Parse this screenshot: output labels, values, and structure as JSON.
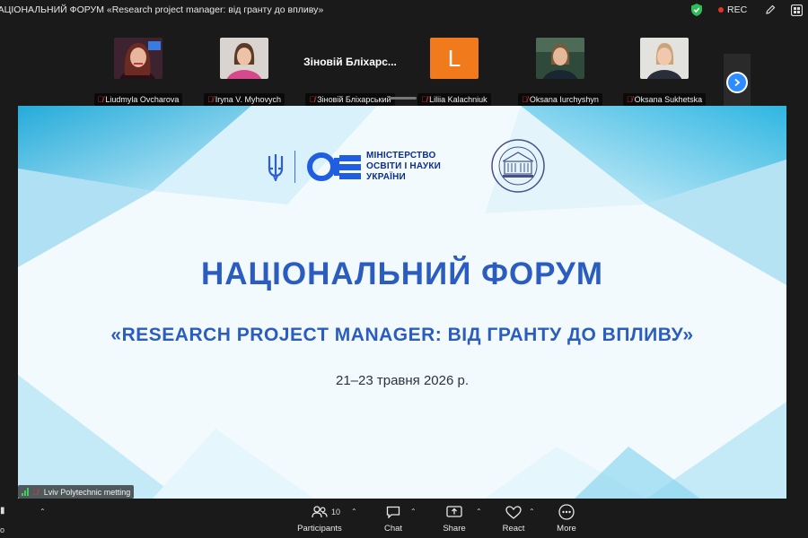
{
  "window": {
    "title": "НАЦІОНАЛЬНИЙ ФОРУМ  «Research project manager: від гранту до впливу»"
  },
  "topbar": {
    "rec_label": "REC",
    "shield_icon": "shield-check-icon",
    "annotate_icon": "pencil-icon",
    "apps_icon": "apps-grid-icon"
  },
  "participants_strip": {
    "tiles": [
      {
        "name": "Liudmyla Ovcharova",
        "muted": true
      },
      {
        "name": "Iryna V. Myhovych",
        "muted": true
      },
      {
        "name": "Зіновій Бліхарський",
        "display": "Зіновій Бліхарс...",
        "muted": true
      },
      {
        "name": "Liliia Kalachniuk",
        "initial": "L",
        "muted": true
      },
      {
        "name": "Oksana Iurchyshyn",
        "muted": true
      },
      {
        "name": "Oksana Sukhetska",
        "muted": true
      }
    ],
    "next_icon": "chevron-right-icon"
  },
  "slide": {
    "ministry": {
      "line1": "МІНІСТЕРСТВО",
      "line2": "ОСВІТИ І НАУКИ",
      "line3": "УКРАЇНИ"
    },
    "title": "НАЦІОНАЛЬНИЙ ФОРУМ",
    "subtitle": "«RESEARCH PROJECT MANAGER: ВІД ГРАНТУ ДО ВПЛИВУ»",
    "date": "21–23 травня 2026 р.",
    "colors": {
      "title": "#2a5dbf",
      "ministry": "#0c2e8e",
      "accent_cyan": "#2cb7e0"
    }
  },
  "active_speaker": {
    "label": "Lviv Polytechnic metting",
    "muted": true
  },
  "toolbar": {
    "left_edge_label": "o",
    "participants": {
      "label": "Participants",
      "count": "10"
    },
    "chat": {
      "label": "Chat"
    },
    "share": {
      "label": "Share"
    },
    "react": {
      "label": "React"
    },
    "more": {
      "label": "More"
    }
  }
}
